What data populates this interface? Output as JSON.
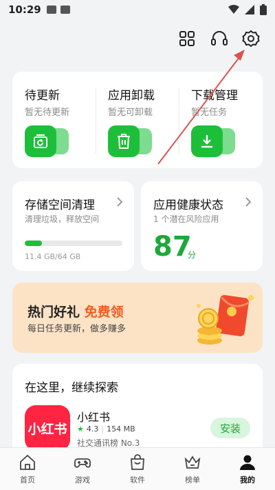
{
  "status_bar": {
    "time": "10:29"
  },
  "downloads_card": {
    "columns": [
      {
        "title": "待更新",
        "subtitle": "暂无待更新",
        "icon": "refresh-icon"
      },
      {
        "title": "应用卸载",
        "subtitle": "暂无可卸载",
        "icon": "trash-icon"
      },
      {
        "title": "下载管理",
        "subtitle": "暂无任务",
        "icon": "download-icon"
      }
    ]
  },
  "storage_card": {
    "title": "存储空间清理",
    "subtitle": "清理垃圾，释放空间",
    "used_fraction": 0.178,
    "usage_text": "11.4 GB/64 GB"
  },
  "health_card": {
    "title": "应用健康状态",
    "subtitle": "1 个潜在风险应用",
    "score": "87",
    "score_unit": "分"
  },
  "promo": {
    "title_prefix": "热门好礼",
    "title_highlight": "免费领",
    "subtitle": "每日任务更新，做多赚多"
  },
  "explore": {
    "title": "在这里，继续探索",
    "app": {
      "logo_text": "小红书",
      "name": "小红书",
      "rating": "4.3",
      "size": "154 MB",
      "rank": "社交通讯榜 No.3",
      "install_label": "安装"
    }
  },
  "tabs": [
    {
      "label": "首页",
      "icon": "home-icon",
      "active": false
    },
    {
      "label": "游戏",
      "icon": "gamepad-icon",
      "active": false
    },
    {
      "label": "软件",
      "icon": "shopping-bag-icon",
      "active": false
    },
    {
      "label": "榜单",
      "icon": "crown-icon",
      "active": false
    },
    {
      "label": "我的",
      "icon": "user-icon",
      "active": true
    }
  ],
  "colors": {
    "accent_green": "#1dbf3a",
    "promo_highlight": "#f25c1e",
    "brand_xiaohongshu": "#ff2442",
    "annotation_arrow": "#d9534f"
  }
}
